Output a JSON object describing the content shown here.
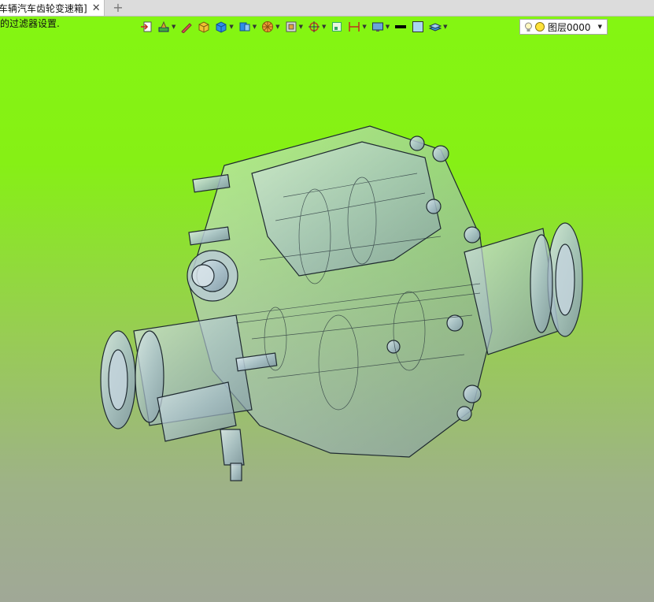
{
  "tab": {
    "title": "车辆汽车齿轮变速箱]",
    "close": "✕",
    "add": "+"
  },
  "hint": "的过滤器设置.",
  "layer": {
    "name": "图层0000",
    "caret": "▼"
  },
  "colors": {
    "viewport_top": "#84f612",
    "viewport_bottom": "#a0a897",
    "model": "#aec7d4"
  },
  "toolbar_icons": [
    "exit-icon",
    "tool-icon",
    "pencil-icon",
    "box-solid-icon",
    "cube-icon",
    "shaded-view-icon",
    "wheel-icon",
    "frame-icon",
    "snap-icon",
    "square-icon",
    "measure-icon",
    "display-icon",
    "line-color-icon",
    "fill-color-icon",
    "layer-stack-icon"
  ]
}
